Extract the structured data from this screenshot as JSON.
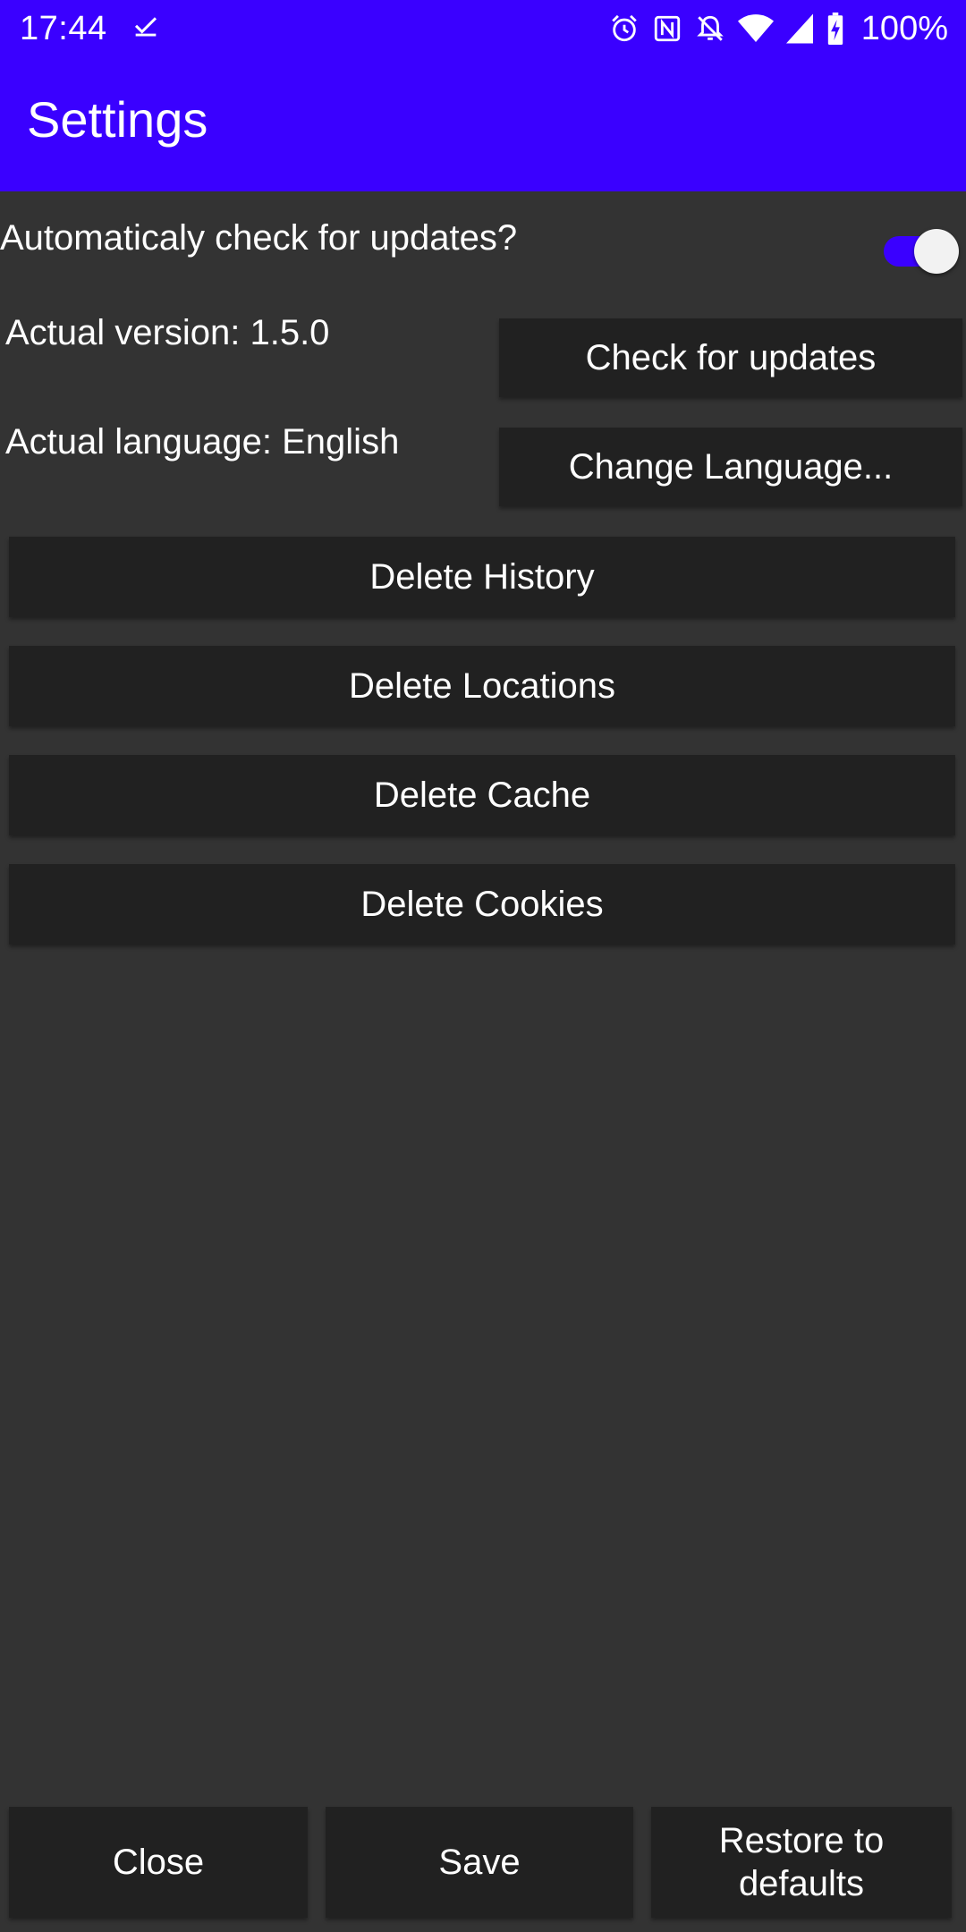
{
  "status_bar": {
    "time": "17:44",
    "battery": "100%",
    "icons": [
      "download-done-icon",
      "alarm-icon",
      "nfc-icon",
      "notifications-off-icon",
      "wifi-icon",
      "cell-signal-icon",
      "battery-charging-icon"
    ]
  },
  "app_bar": {
    "title": "Settings"
  },
  "settings": {
    "auto_update_label": "Automaticaly check for updates?",
    "auto_update_enabled": true,
    "version_label": "Actual version: 1.5.0",
    "check_updates_button": "Check for updates",
    "language_label": "Actual language: English",
    "change_language_button": "Change Language...",
    "delete_history_button": "Delete History",
    "delete_locations_button": "Delete Locations",
    "delete_cache_button": "Delete Cache",
    "delete_cookies_button": "Delete Cookies"
  },
  "footer": {
    "close_button": "Close",
    "save_button": "Save",
    "restore_line1": "Restore to",
    "restore_line2": "defaults"
  },
  "colors": {
    "accent": "#3a00ff",
    "background": "#333333",
    "button": "#212121",
    "text": "#ffffff"
  }
}
